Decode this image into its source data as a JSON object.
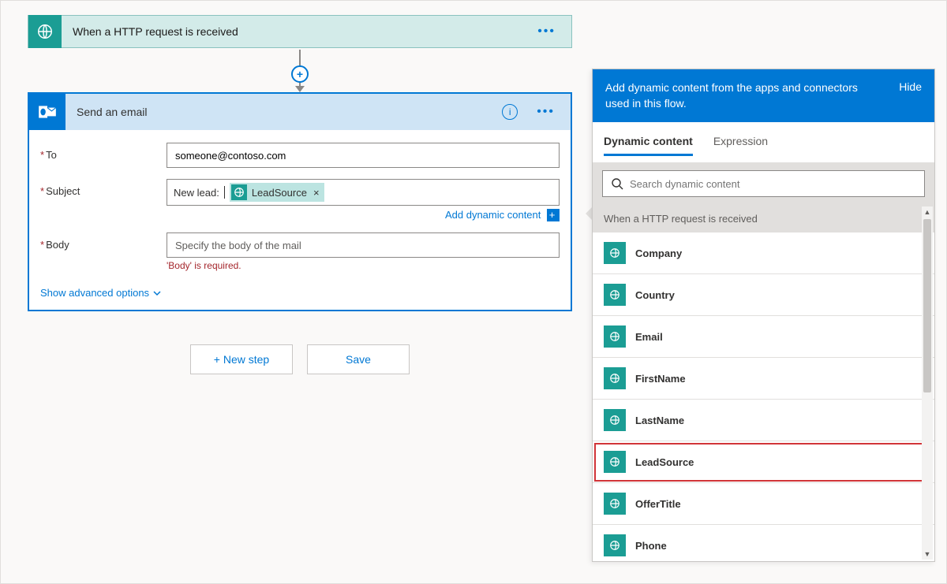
{
  "trigger": {
    "title": "When a HTTP request is received"
  },
  "action": {
    "title": "Send an email",
    "fields": {
      "to_label": "To",
      "to_value": "someone@contoso.com",
      "subject_label": "Subject",
      "subject_prefix": "New lead:",
      "subject_token": "LeadSource",
      "add_dynamic_link": "Add dynamic content",
      "body_label": "Body",
      "body_placeholder": "Specify the body of the mail",
      "body_error": "'Body' is required."
    },
    "advanced_link": "Show advanced options"
  },
  "buttons": {
    "new_step": "+ New step",
    "save": "Save"
  },
  "dyn_panel": {
    "header_text": "Add dynamic content from the apps and connectors used in this flow.",
    "hide_label": "Hide",
    "tab_dynamic": "Dynamic content",
    "tab_expression": "Expression",
    "search_placeholder": "Search dynamic content",
    "section_title": "When a HTTP request is received",
    "items": [
      {
        "label": "Company"
      },
      {
        "label": "Country"
      },
      {
        "label": "Email"
      },
      {
        "label": "FirstName"
      },
      {
        "label": "LastName"
      },
      {
        "label": "LeadSource",
        "highlight": true
      },
      {
        "label": "OfferTitle"
      },
      {
        "label": "Phone"
      }
    ]
  }
}
